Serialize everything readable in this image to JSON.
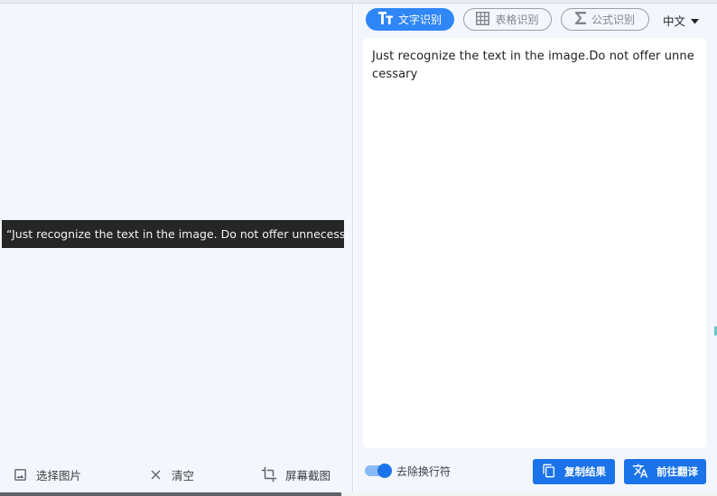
{
  "left": {
    "preview_text": "“Just recognize the text in the image. Do not offer unnecessary",
    "actions": [
      {
        "label": "选择图片",
        "icon": "image-icon"
      },
      {
        "label": "清空",
        "icon": "close-icon"
      },
      {
        "label": "屏幕截图",
        "icon": "crop-icon"
      }
    ]
  },
  "right": {
    "tabs": [
      {
        "label": "文字识别",
        "icon": "text-format-icon",
        "active": true
      },
      {
        "label": "表格识别",
        "icon": "table-icon",
        "active": false
      },
      {
        "label": "公式识别",
        "icon": "sigma-icon",
        "active": false
      }
    ],
    "language": "中文",
    "result_text": "Just recognize the text in the image.Do not offer unnecessary",
    "toggle_label": "去除换行符",
    "toggle_on": true,
    "copy_label": "复制结果",
    "translate_label": "前往翻译"
  },
  "colors": {
    "accent": "#1a73e8",
    "tab_active": "#2f86f6",
    "pane_bg": "#f3f6fc",
    "preview_bg": "#262626"
  }
}
